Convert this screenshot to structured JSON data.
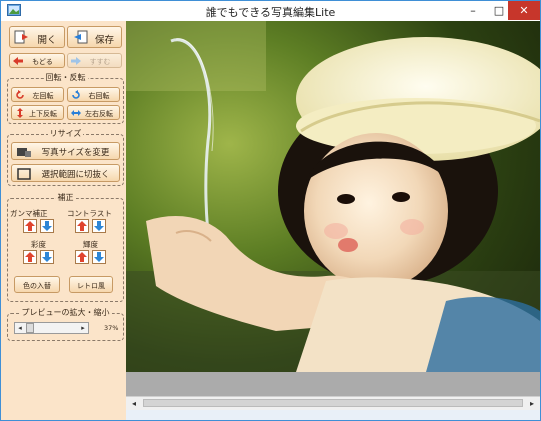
{
  "window": {
    "title": "誰でもできる写真編集Lite",
    "min_glyph": "–",
    "max_glyph": "□",
    "close_glyph": "✕"
  },
  "toolbar": {
    "open_label": "開く",
    "save_label": "保存",
    "undo_label": "もどる",
    "redo_label": "すすむ"
  },
  "rotate": {
    "title": "回転・反転",
    "left_label": "左回転",
    "right_label": "右回転",
    "vflip_label": "上下反転",
    "hflip_label": "左右反転"
  },
  "resize": {
    "title": "リサイズ",
    "change_size_label": "写真サイズを変更",
    "crop_label": "選択範囲に切抜く"
  },
  "correction": {
    "title": "補正",
    "gamma_label": "ガンマ補正",
    "contrast_label": "コントラスト",
    "saturation_label": "彩度",
    "brightness_label": "輝度",
    "swap_colors_label": "色の入替",
    "retro_label": "レトロ風"
  },
  "preview": {
    "title": "プレビューの拡大・縮小",
    "zoom_text": "37%",
    "zoom_value": 37
  },
  "photo": {
    "subject": "child drinking water"
  }
}
